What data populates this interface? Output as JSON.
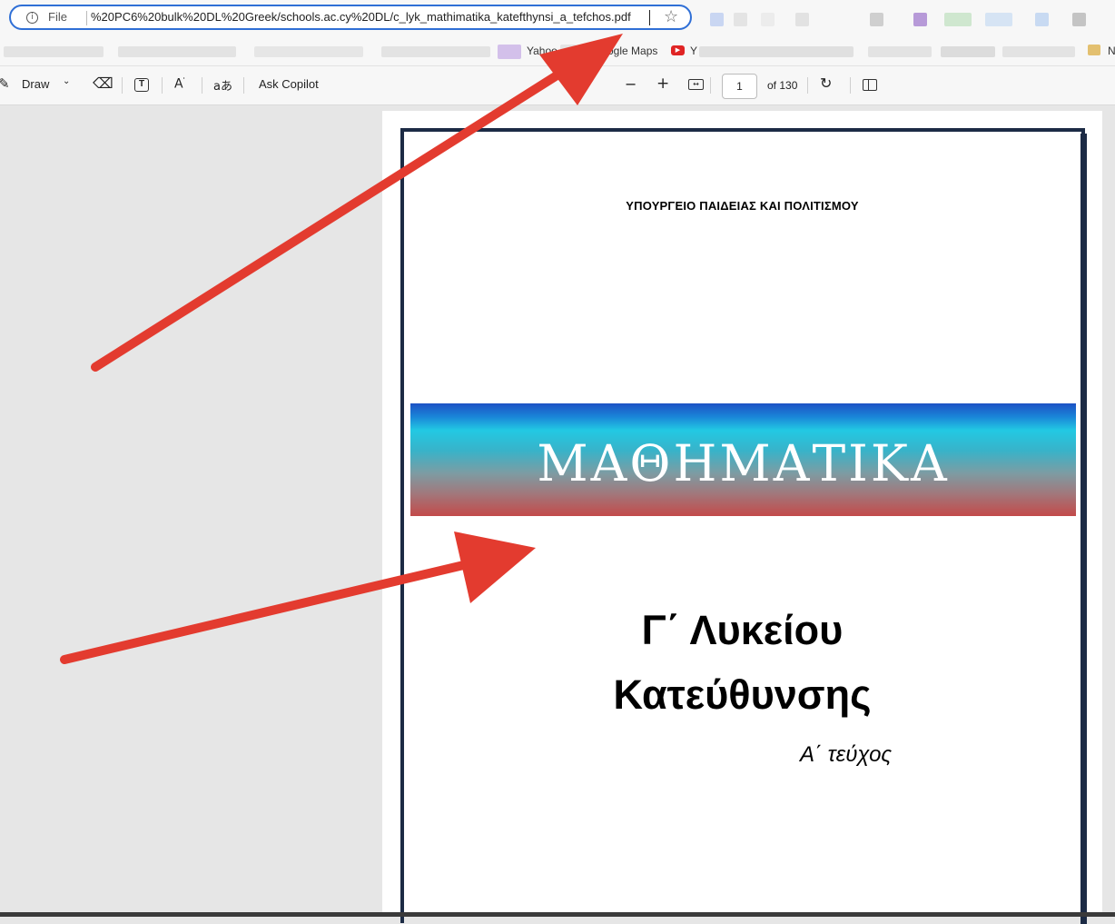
{
  "address_bar": {
    "scheme_label": "File",
    "url": "%20PC6%20bulk%20DL%20Greek/schools.ac.cy%20DL/c_lyk_mathimatika_katefthynsi_a_tefchos.pdf",
    "info_icon": "info-icon",
    "star_icon": "star-icon"
  },
  "bookmarks": {
    "items": [
      "Yahoo",
      "Google Maps",
      "Y",
      "N"
    ]
  },
  "toolbar": {
    "draw_label": "Draw",
    "ask_copilot_label": "Ask Copilot",
    "zoom_out": "−",
    "zoom_in": "+",
    "page_number": "1",
    "page_total": "of 130",
    "icons": [
      "draw-icon",
      "chevron-down-icon",
      "eraser-icon",
      "text-box-icon",
      "read-aloud-icon",
      "translate-icon",
      "zoom-out-icon",
      "zoom-in-icon",
      "fit-to-width-icon",
      "rotate-icon",
      "page-view-icon"
    ]
  },
  "document": {
    "ministry": "ΥΠΟΥΡΓΕΙΟ ΠΑΙΔΕΙΑΣ ΚΑΙ ΠΟΛΙΤΙΣΜΟΥ",
    "subject": "ΜΑΘΗΜΑΤΙΚΑ",
    "grade": "Γ΄ Λυκείου",
    "track": "Κατεύθυνσης",
    "volume": "Α΄ τεύχος"
  },
  "annotations": {
    "arrow_color": "#e33b2f"
  },
  "colors": {
    "address_focus": "#2f6fd6",
    "page_frame": "#1c2b45"
  }
}
